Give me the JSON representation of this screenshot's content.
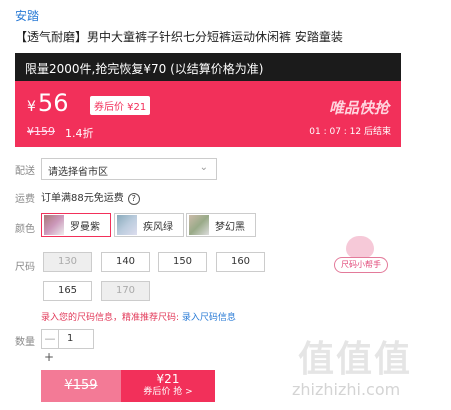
{
  "brand": "安踏",
  "title": "【透气耐磨】男中大童裤子针织七分短裤运动休闲裤 安踏童装",
  "promo": {
    "banner": "限量2000件,抢完恢复¥70 (以结算价格为准)",
    "price_symbol": "¥",
    "price": "56",
    "coupon_tag": "券后价 ¥21",
    "original_price": "¥159",
    "discount": "1.4折",
    "vip_logo": "唯品快抢",
    "countdown": "01 : 07 : 12  后结束",
    "colors": {
      "black_bar": "#1b1b1b",
      "red_panel": "#f2305a"
    }
  },
  "delivery": {
    "label": "配送",
    "select_value": "请选择省市区",
    "chevron_icon": "chevron-down-icon"
  },
  "shipping": {
    "label": "运费",
    "text": "订单满88元免运费",
    "help": "?"
  },
  "color_row": {
    "label": "颜色",
    "options": [
      {
        "label": "罗曼紫",
        "selected": true
      },
      {
        "label": "疾风绿",
        "selected": false
      },
      {
        "label": "梦幻黑",
        "selected": false
      }
    ]
  },
  "size_row": {
    "label": "尺码",
    "options": [
      {
        "label": "130",
        "disabled": true
      },
      {
        "label": "140",
        "disabled": false
      },
      {
        "label": "150",
        "disabled": false
      },
      {
        "label": "160",
        "disabled": false
      },
      {
        "label": "165",
        "disabled": false
      },
      {
        "label": "170",
        "disabled": true
      }
    ],
    "helper_button": "尺码小帮手",
    "tip_prefix": "录入您的尺码信息，精准推荐尺码:",
    "tip_link": "录入尺码信息"
  },
  "quantity": {
    "label": "数量",
    "minus": "—",
    "value": "1",
    "plus": "+"
  },
  "buy": {
    "original_button": "¥159",
    "coupon_price": "¥21",
    "coupon_action": "券后价 抢 >"
  },
  "watermark": {
    "text": "值值值",
    "url": "zhizhizhi.com"
  }
}
